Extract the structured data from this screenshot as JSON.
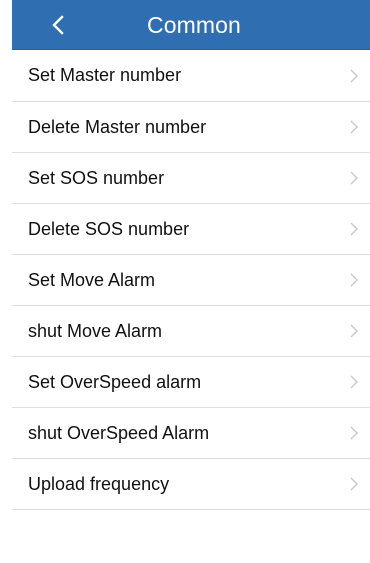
{
  "header": {
    "title": "Common",
    "back_icon": "chevron-left-icon"
  },
  "colors": {
    "header_background": "#2f6fb1",
    "header_text": "#ffffff",
    "item_text": "#111111",
    "divider": "#dedede",
    "chevron": "#c7c7cc"
  },
  "menu": {
    "items": [
      {
        "label": "Set Master number",
        "icon": "chevron-right-icon"
      },
      {
        "label": "Delete Master number",
        "icon": "chevron-right-icon"
      },
      {
        "label": "Set SOS number",
        "icon": "chevron-right-icon"
      },
      {
        "label": "Delete SOS number",
        "icon": "chevron-right-icon"
      },
      {
        "label": "Set Move Alarm",
        "icon": "chevron-right-icon"
      },
      {
        "label": "shut Move Alarm",
        "icon": "chevron-right-icon"
      },
      {
        "label": "Set OverSpeed alarm",
        "icon": "chevron-right-icon"
      },
      {
        "label": "shut OverSpeed Alarm",
        "icon": "chevron-right-icon"
      },
      {
        "label": "Upload frequency",
        "icon": "chevron-right-icon"
      }
    ]
  }
}
